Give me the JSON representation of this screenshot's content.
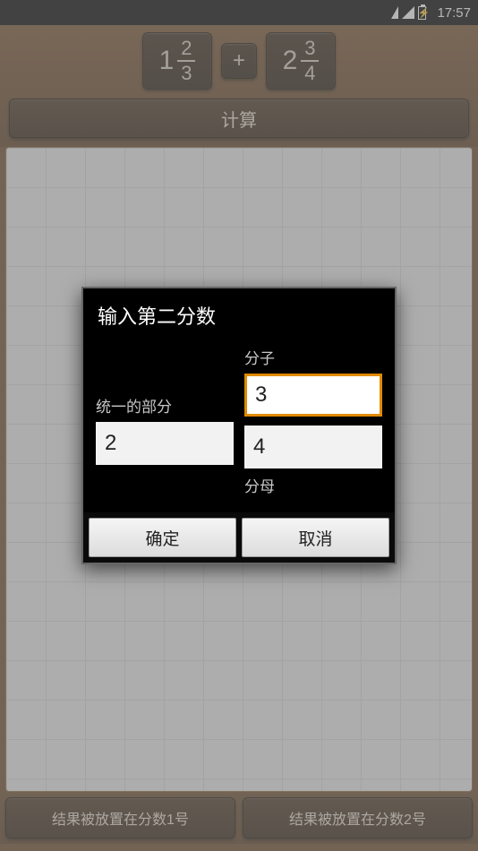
{
  "status": {
    "time": "17:57"
  },
  "fractions": {
    "first": {
      "whole": "1",
      "num": "2",
      "den": "3"
    },
    "op": "+",
    "second": {
      "whole": "2",
      "num": "3",
      "den": "4"
    }
  },
  "buttons": {
    "calculate": "计算",
    "result_to_1": "结果被放置在分数1号",
    "result_to_2": "结果被放置在分数2号"
  },
  "dialog": {
    "title": "输入第二分数",
    "whole_label": "统一的部分",
    "numerator_label": "分子",
    "denominator_label": "分母",
    "whole_value": "2",
    "numerator_value": "3",
    "denominator_value": "4",
    "ok": "确定",
    "cancel": "取消"
  }
}
